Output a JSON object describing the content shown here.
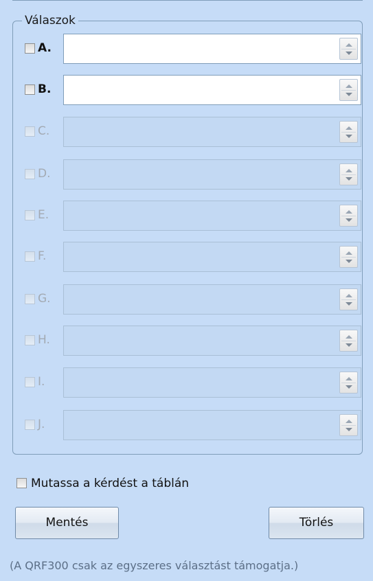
{
  "group": {
    "title": "Válaszok"
  },
  "answers": [
    {
      "letter": "A.",
      "value": "",
      "enabled": true
    },
    {
      "letter": "B.",
      "value": "",
      "enabled": true
    },
    {
      "letter": "C.",
      "value": "",
      "enabled": false
    },
    {
      "letter": "D.",
      "value": "",
      "enabled": false
    },
    {
      "letter": "E.",
      "value": "",
      "enabled": false
    },
    {
      "letter": "F.",
      "value": "",
      "enabled": false
    },
    {
      "letter": "G.",
      "value": "",
      "enabled": false
    },
    {
      "letter": "H.",
      "value": "",
      "enabled": false
    },
    {
      "letter": "I.",
      "value": "",
      "enabled": false
    },
    {
      "letter": "J.",
      "value": "",
      "enabled": false
    }
  ],
  "show_on_board": {
    "label": "Mutassa a kérdést a táblán",
    "checked": false
  },
  "buttons": {
    "save_label": "Mentés",
    "delete_label": "Törlés"
  },
  "note": "(A QRF300 csak az egyszeres választást támogatja.)",
  "icons": {
    "checkbox": "checkbox-unchecked-icon",
    "spin_up": "spin-up-icon",
    "spin_down": "spin-down-icon"
  },
  "colors": {
    "background": "#c6dcf7",
    "field_enabled": "#ffffff",
    "field_disabled": "#c3d9f3",
    "border": "#7f9db9",
    "disabled_text": "#a3aab3",
    "note_text": "#5c6f87"
  }
}
